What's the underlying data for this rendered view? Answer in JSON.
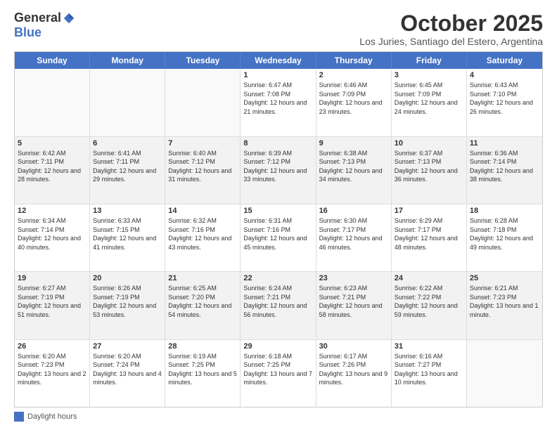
{
  "logo": {
    "general": "General",
    "blue": "Blue"
  },
  "title": "October 2025",
  "subtitle": "Los Juries, Santiago del Estero, Argentina",
  "days": [
    "Sunday",
    "Monday",
    "Tuesday",
    "Wednesday",
    "Thursday",
    "Friday",
    "Saturday"
  ],
  "weeks": [
    [
      {
        "day": "",
        "text": ""
      },
      {
        "day": "",
        "text": ""
      },
      {
        "day": "",
        "text": ""
      },
      {
        "day": "1",
        "text": "Sunrise: 6:47 AM\nSunset: 7:08 PM\nDaylight: 12 hours and 21 minutes."
      },
      {
        "day": "2",
        "text": "Sunrise: 6:46 AM\nSunset: 7:09 PM\nDaylight: 12 hours and 23 minutes."
      },
      {
        "day": "3",
        "text": "Sunrise: 6:45 AM\nSunset: 7:09 PM\nDaylight: 12 hours and 24 minutes."
      },
      {
        "day": "4",
        "text": "Sunrise: 6:43 AM\nSunset: 7:10 PM\nDaylight: 12 hours and 26 minutes."
      }
    ],
    [
      {
        "day": "5",
        "text": "Sunrise: 6:42 AM\nSunset: 7:11 PM\nDaylight: 12 hours and 28 minutes."
      },
      {
        "day": "6",
        "text": "Sunrise: 6:41 AM\nSunset: 7:11 PM\nDaylight: 12 hours and 29 minutes."
      },
      {
        "day": "7",
        "text": "Sunrise: 6:40 AM\nSunset: 7:12 PM\nDaylight: 12 hours and 31 minutes."
      },
      {
        "day": "8",
        "text": "Sunrise: 6:39 AM\nSunset: 7:12 PM\nDaylight: 12 hours and 33 minutes."
      },
      {
        "day": "9",
        "text": "Sunrise: 6:38 AM\nSunset: 7:13 PM\nDaylight: 12 hours and 34 minutes."
      },
      {
        "day": "10",
        "text": "Sunrise: 6:37 AM\nSunset: 7:13 PM\nDaylight: 12 hours and 36 minutes."
      },
      {
        "day": "11",
        "text": "Sunrise: 6:36 AM\nSunset: 7:14 PM\nDaylight: 12 hours and 38 minutes."
      }
    ],
    [
      {
        "day": "12",
        "text": "Sunrise: 6:34 AM\nSunset: 7:14 PM\nDaylight: 12 hours and 40 minutes."
      },
      {
        "day": "13",
        "text": "Sunrise: 6:33 AM\nSunset: 7:15 PM\nDaylight: 12 hours and 41 minutes."
      },
      {
        "day": "14",
        "text": "Sunrise: 6:32 AM\nSunset: 7:16 PM\nDaylight: 12 hours and 43 minutes."
      },
      {
        "day": "15",
        "text": "Sunrise: 6:31 AM\nSunset: 7:16 PM\nDaylight: 12 hours and 45 minutes."
      },
      {
        "day": "16",
        "text": "Sunrise: 6:30 AM\nSunset: 7:17 PM\nDaylight: 12 hours and 46 minutes."
      },
      {
        "day": "17",
        "text": "Sunrise: 6:29 AM\nSunset: 7:17 PM\nDaylight: 12 hours and 48 minutes."
      },
      {
        "day": "18",
        "text": "Sunrise: 6:28 AM\nSunset: 7:18 PM\nDaylight: 12 hours and 49 minutes."
      }
    ],
    [
      {
        "day": "19",
        "text": "Sunrise: 6:27 AM\nSunset: 7:19 PM\nDaylight: 12 hours and 51 minutes."
      },
      {
        "day": "20",
        "text": "Sunrise: 6:26 AM\nSunset: 7:19 PM\nDaylight: 12 hours and 53 minutes."
      },
      {
        "day": "21",
        "text": "Sunrise: 6:25 AM\nSunset: 7:20 PM\nDaylight: 12 hours and 54 minutes."
      },
      {
        "day": "22",
        "text": "Sunrise: 6:24 AM\nSunset: 7:21 PM\nDaylight: 12 hours and 56 minutes."
      },
      {
        "day": "23",
        "text": "Sunrise: 6:23 AM\nSunset: 7:21 PM\nDaylight: 12 hours and 58 minutes."
      },
      {
        "day": "24",
        "text": "Sunrise: 6:22 AM\nSunset: 7:22 PM\nDaylight: 12 hours and 59 minutes."
      },
      {
        "day": "25",
        "text": "Sunrise: 6:21 AM\nSunset: 7:23 PM\nDaylight: 13 hours and 1 minute."
      }
    ],
    [
      {
        "day": "26",
        "text": "Sunrise: 6:20 AM\nSunset: 7:23 PM\nDaylight: 13 hours and 2 minutes."
      },
      {
        "day": "27",
        "text": "Sunrise: 6:20 AM\nSunset: 7:24 PM\nDaylight: 13 hours and 4 minutes."
      },
      {
        "day": "28",
        "text": "Sunrise: 6:19 AM\nSunset: 7:25 PM\nDaylight: 13 hours and 5 minutes."
      },
      {
        "day": "29",
        "text": "Sunrise: 6:18 AM\nSunset: 7:25 PM\nDaylight: 13 hours and 7 minutes."
      },
      {
        "day": "30",
        "text": "Sunrise: 6:17 AM\nSunset: 7:26 PM\nDaylight: 13 hours and 9 minutes."
      },
      {
        "day": "31",
        "text": "Sunrise: 6:16 AM\nSunset: 7:27 PM\nDaylight: 13 hours and 10 minutes."
      },
      {
        "day": "",
        "text": ""
      }
    ]
  ],
  "footer": {
    "swatch_label": "Daylight hours"
  }
}
